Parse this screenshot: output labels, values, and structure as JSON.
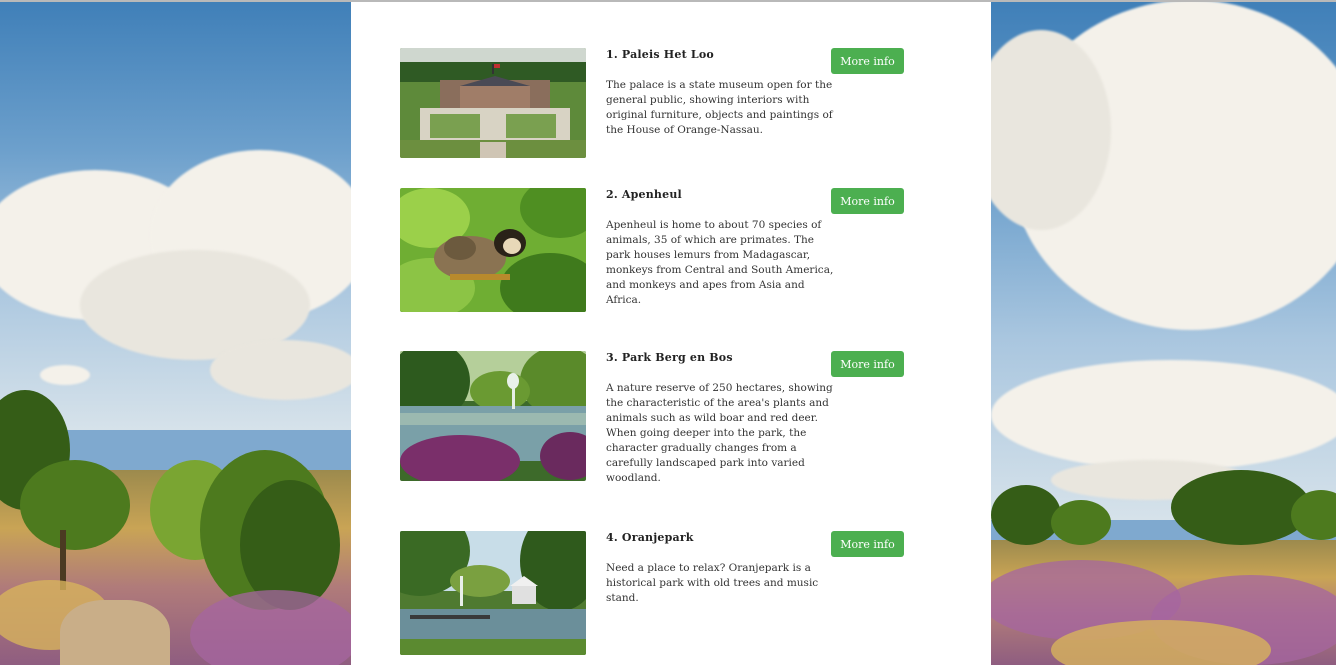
{
  "attractions": [
    {
      "title": "1. Paleis Het Loo",
      "description": "The palace is a state museum open for the general public, showing interiors with original furniture, objects and paintings of the House of Orange-Nassau.",
      "button_label": "More info",
      "image_subject": "palace-with-gardens"
    },
    {
      "title": "2. Apenheul",
      "description": "Apenheul is home to about 70 species of animals, 35 of which are primates. The park houses lemurs from Madagascar, monkeys from Central and South America, and monkeys and apes from Asia and Africa.",
      "button_label": "More info",
      "image_subject": "monkey-in-tree"
    },
    {
      "title": "3. Park Berg en Bos",
      "description": "A nature reserve of 250 hectares, showing the characteristic of the area's plants and animals such as wild boar and red deer. When going deeper into the park, the character gradually changes from a carefully landscaped park into varied woodland.",
      "button_label": "More info",
      "image_subject": "pond-with-fountain"
    },
    {
      "title": "4. Oranjepark",
      "description": "Need a place to relax? Oranjepark is a historical park with old trees and music stand.",
      "button_label": "More info",
      "image_subject": "park-pond-with-music-stand"
    }
  ],
  "colors": {
    "button_bg": "#4caf50",
    "button_text": "#ffffff",
    "content_bg": "#ffffff"
  }
}
